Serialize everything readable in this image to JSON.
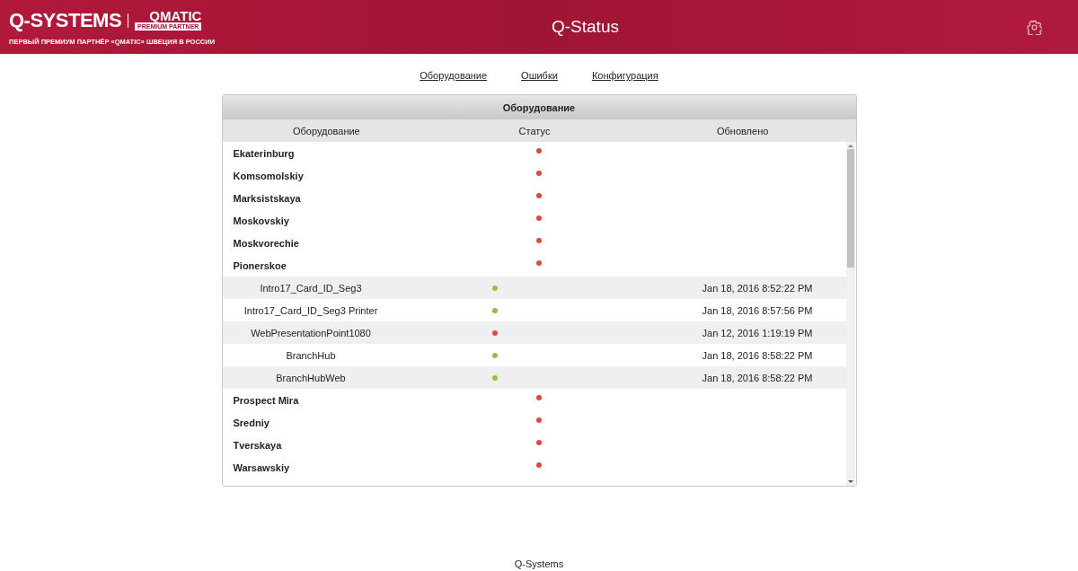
{
  "header": {
    "logo": {
      "brand": "Q-SYSTEMS",
      "partner": "QMATIC",
      "partner_badge": "PREMIUM PARTNER",
      "tagline": "ПЕРВЫЙ ПРЕМИУМ ПАРТНЁР «QMATIC» ШВЕЦИЯ В РОССИИ"
    },
    "title": "Q-Status"
  },
  "nav": [
    "Оборудование",
    "Ошибки",
    "Конфигурация"
  ],
  "panel": {
    "title": "Оборудование",
    "columns": [
      "Оборудование",
      "Статус",
      "Обновлено"
    ],
    "branches": [
      {
        "name": "Ekaterinburg",
        "color": "#e04848"
      },
      {
        "name": "Komsomolskiy",
        "color": "#e04848"
      },
      {
        "name": "Marksistskaya",
        "color": "#e04848"
      },
      {
        "name": "Moskovskiy",
        "color": "#e04848"
      },
      {
        "name": "Moskvorechie",
        "color": "#e04848"
      },
      {
        "name": "Pionerskoe",
        "color": "#e04848",
        "children": [
          {
            "name": "Intro17_Card_ID_Seg3",
            "color": "#8cc63f",
            "updated": "Jan 18, 2016 8:52:22 PM"
          },
          {
            "name": "Intro17_Card_ID_Seg3 Printer",
            "color": "#8cc63f",
            "updated": "Jan 18, 2016 8:57:56 PM"
          },
          {
            "name": "WebPresentationPoint1080",
            "color": "#e04848",
            "updated": "Jan 12, 2016 1:19:19 PM"
          },
          {
            "name": "BranchHub",
            "color": "#8cc63f",
            "updated": "Jan 18, 2016 8:58:22 PM"
          },
          {
            "name": "BranchHubWeb",
            "color": "#8cc63f",
            "updated": "Jan 18, 2016 8:58:22 PM"
          }
        ]
      },
      {
        "name": "Prospect Mira",
        "color": "#e04848"
      },
      {
        "name": "Sredniy",
        "color": "#e04848"
      },
      {
        "name": "Tverskaya",
        "color": "#e04848"
      },
      {
        "name": "Warsawskiy",
        "color": "#e04848"
      }
    ]
  },
  "footer": "Q-Systems"
}
